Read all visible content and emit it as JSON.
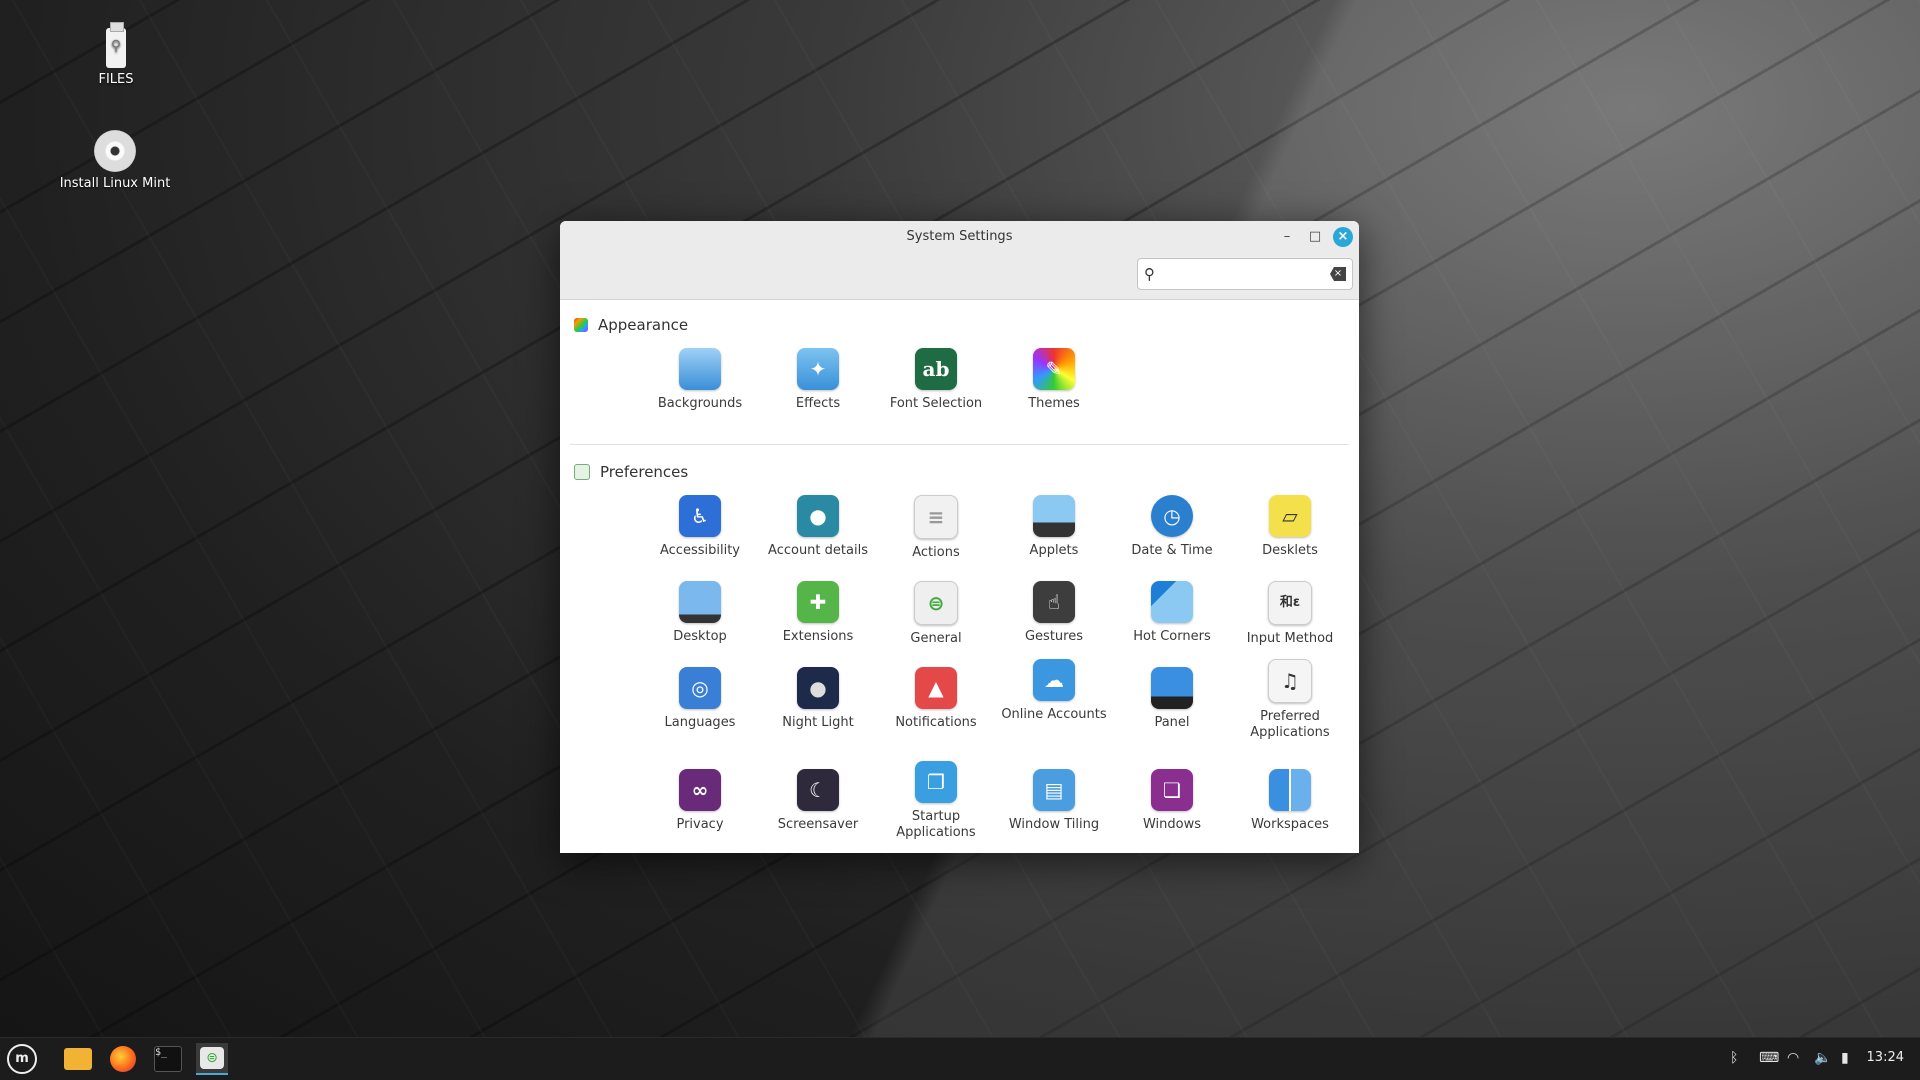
{
  "desktop": {
    "icons": [
      {
        "label": "FILES",
        "icon": "usb-drive-icon"
      },
      {
        "label": "Install Linux Mint",
        "icon": "disc-icon"
      }
    ]
  },
  "window": {
    "title": "System Settings",
    "search": {
      "value": "",
      "placeholder": ""
    },
    "sections": [
      {
        "title": "Appearance",
        "items": [
          {
            "label": "Backgrounds",
            "icon": "backgrounds-icon"
          },
          {
            "label": "Effects",
            "icon": "effects-icon"
          },
          {
            "label": "Font Selection",
            "icon": "font-selection-icon"
          },
          {
            "label": "Themes",
            "icon": "themes-icon"
          }
        ]
      },
      {
        "title": "Preferences",
        "items": [
          {
            "label": "Accessibility",
            "icon": "accessibility-icon"
          },
          {
            "label": "Account details",
            "icon": "account-details-icon"
          },
          {
            "label": "Actions",
            "icon": "actions-icon"
          },
          {
            "label": "Applets",
            "icon": "applets-icon"
          },
          {
            "label": "Date & Time",
            "icon": "clock-icon"
          },
          {
            "label": "Desklets",
            "icon": "desklets-icon"
          },
          {
            "label": "Desktop",
            "icon": "desktop-icon"
          },
          {
            "label": "Extensions",
            "icon": "puzzle-icon"
          },
          {
            "label": "General",
            "icon": "toggles-icon"
          },
          {
            "label": "Gestures",
            "icon": "hand-pointer-icon"
          },
          {
            "label": "Hot Corners",
            "icon": "hot-corners-icon"
          },
          {
            "label": "Input Method",
            "icon": "input-method-icon"
          },
          {
            "label": "Languages",
            "icon": "globe-icon"
          },
          {
            "label": "Night Light",
            "icon": "moon-icon"
          },
          {
            "label": "Notifications",
            "icon": "bell-icon"
          },
          {
            "label": "Online Accounts",
            "icon": "cloud-icon"
          },
          {
            "label": "Panel",
            "icon": "panel-icon"
          },
          {
            "label": "Preferred Applications",
            "icon": "preferred-apps-icon"
          },
          {
            "label": "Privacy",
            "icon": "mask-icon"
          },
          {
            "label": "Screensaver",
            "icon": "crescent-icon"
          },
          {
            "label": "Startup Applications",
            "icon": "startup-icon"
          },
          {
            "label": "Window Tiling",
            "icon": "tiling-icon"
          },
          {
            "label": "Windows",
            "icon": "windows-icon"
          },
          {
            "label": "Workspaces",
            "icon": "workspaces-icon"
          }
        ]
      }
    ]
  },
  "taskbar": {
    "apps": [
      {
        "name": "menu",
        "icon": "mint-menu-icon"
      },
      {
        "name": "files",
        "icon": "folder-icon"
      },
      {
        "name": "firefox",
        "icon": "firefox-icon"
      },
      {
        "name": "terminal",
        "icon": "terminal-icon"
      },
      {
        "name": "settings",
        "icon": "settings-icon"
      }
    ],
    "tray": [
      "bluetooth-icon",
      "keyboard-layout-icon",
      "wifi-icon",
      "volume-icon",
      "battery-icon"
    ],
    "clock": "13:24"
  },
  "colors": {
    "accent": "#2aa7d6",
    "taskbar": "#1c1c1c"
  }
}
